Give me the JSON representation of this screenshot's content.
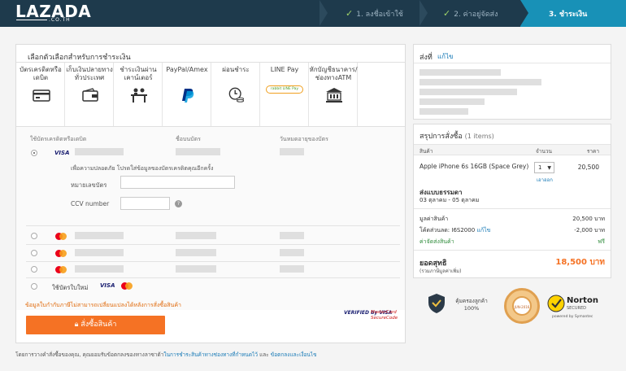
{
  "header": {
    "logo": "LAZADA",
    "logo_sub": ".CO.TH",
    "steps": [
      {
        "label": "1. ลงชื่อเข้าใช้",
        "done": true
      },
      {
        "label": "2. ค่าอยู่จัดส่ง",
        "done": true
      },
      {
        "label": "3. ชำระเงิน",
        "done": false
      }
    ]
  },
  "payment": {
    "title": "เลือกตัวเลือกสำหรับการชำระเงิน",
    "tabs": [
      {
        "label": "บัตรเครดิตหรือเดบิต",
        "icon": "credit-card-icon"
      },
      {
        "label": "เก็บเงินปลายทางทั่วประเทศ",
        "icon": "wallet-icon"
      },
      {
        "label": "ชำระเงินผ่านเคาน์เตอร์",
        "icon": "counter-icon"
      },
      {
        "label": "PayPal/Amex",
        "icon": "paypal-icon"
      },
      {
        "label": "ผ่อนชำระ",
        "icon": "installment-icon"
      },
      {
        "label": "LINE Pay",
        "icon": "line-pay-icon"
      },
      {
        "label": "หักบัญชีธนาคาร/ช่องทางATM",
        "icon": "bank-icon"
      }
    ],
    "line_pay_badge": "rabbit LINE Pay",
    "columns": {
      "card": "ใช้บัตรเครดิตหรือเดบิต",
      "name": "ชื่อบนบัตร",
      "expiry": "วันหมดอายุของบัตร"
    },
    "visa_label": "VISA",
    "secure_note": "เพื่อความปลอดภัย โปรดใส่ข้อมูลของบัตรเครดิตคุณอีกครั้ง",
    "card_number_label": "หมายเลขบัตร",
    "ccv_label": "CCV number",
    "help_glyph": "?",
    "new_card_label": "ใช้บัตรใบใหม่",
    "notice": "ข้อมูลใบกำกับภาษีไม่สามารถเปลี่ยนแปลงได้หลังการสั่งซื้อสินค้า",
    "order_button": "สั่งซื้อสินค้า",
    "verified_by_visa": "VERIFIED by VISA",
    "mastercard_securecode": "MasterCard SecureCode"
  },
  "footer": {
    "text_before": "โดยการวางคำสั่งซื้อของคุณ, คุณยอมรับข้อตกลงของทางลาซาด้า",
    "link1": "ในการชำระสินค้าทางช่องทางที่กำหนดไว้",
    "text_mid": " และ ",
    "link2": "ข้อตกลงและเงื่อนไข"
  },
  "shipping": {
    "title": "ส่งที่",
    "edit": "แก้ไข"
  },
  "summary": {
    "title": "สรุปการสั่งซื้อ",
    "items": "(1 items)",
    "head_product": "สินค้า",
    "head_qty": "จำนวน",
    "head_price": "ราคา",
    "product_name": "Apple iPhone 6s 16GB (Space Grey)",
    "qty": "1",
    "remove": "เอาออก",
    "price": "20,500",
    "ship_method_label": "ส่งแบบธรรมดา",
    "ship_date": "03 ตุลาคม - 05 ตุลาคม",
    "subtotal_label": "มูลค่าสินค้า",
    "subtotal_value": "20,500 บาท",
    "discount_label": "โค้ดส่วนลด: I6S2000",
    "discount_edit": "แก้ไข",
    "discount_value": "-2,000 บาท",
    "shipping_label": "ค่าจัดส่งสินค้า",
    "shipping_value": "ฟรี",
    "net_label": "ยอดสุทธิ",
    "net_sub": "(รวมภาษีมูลค่าเพิ่ม)",
    "net_value": "18,500 บาท"
  },
  "trust": {
    "protection_text": "คุ้มครองลูกค้า 100%",
    "seal_text": "JUN-2016",
    "norton": "Norton",
    "norton_secured": "SECURED",
    "norton_by": "powered by Symantec"
  },
  "colors": {
    "header_bg": "#1e3a4c",
    "active_step": "#1891b7",
    "accent": "#f57224",
    "link": "#1a7bb7"
  }
}
